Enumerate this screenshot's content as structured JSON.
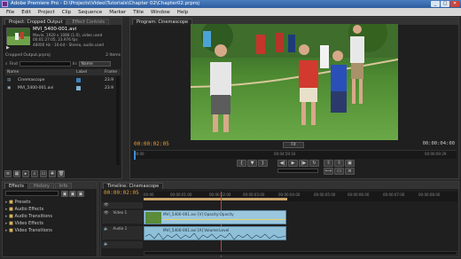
{
  "window": {
    "title": "Adobe Premiere Pro - D:\\Projects\\Video\\Tutorials\\Chapter 02\\Chapter02.prproj"
  },
  "menu": [
    "File",
    "Edit",
    "Project",
    "Clip",
    "Sequence",
    "Marker",
    "Title",
    "Window",
    "Help"
  ],
  "project_panel": {
    "tabs": [
      "Project: Cropped Output",
      "Effect Controls"
    ],
    "clip_name": "MVI_5400-001.avi",
    "clip_info_1": "Movie, 1920 x 1088 (1.0), video used",
    "clip_info_2": "00:01:27:05, 23.976 fps",
    "clip_info_3": "48000 Hz - 16-bit - Stereo, audio used",
    "project_name": "Cropped Output.prproj",
    "items_count": "2 Items",
    "find_label": "Find",
    "in_label": "In:",
    "in_value": "Name",
    "columns": [
      "Name",
      "Label",
      "Frame"
    ],
    "items": [
      {
        "name": "Cinemascope",
        "label_color": "#3b7fb8",
        "rate": "23.9"
      },
      {
        "name": "MVI_5400-001.avi",
        "label_color": "#7fb3d5",
        "rate": "23.9"
      }
    ]
  },
  "program_monitor": {
    "tab": "Program: Cinemascope",
    "current_time": "00:00:02:05",
    "duration": "00:00:04:00",
    "fit": "Fit",
    "ruler_labels": [
      "00:00",
      "00:04:59:16",
      "00:00:09:29"
    ]
  },
  "effects_panel": {
    "tabs": [
      "Effects",
      "History",
      "Info"
    ],
    "folders": [
      "Presets",
      "Audio Effects",
      "Audio Transitions",
      "Video Effects",
      "Video Transitions"
    ]
  },
  "timeline": {
    "tab": "Timeline: Cinemascope",
    "current_time": "00:00:02:05",
    "ruler_labels": [
      "00:00",
      "00:00:01:00",
      "00:00:02:00",
      "00:00:03:00",
      "00:00:04:00",
      "00:00:05:00",
      "00:00:06:00",
      "00:00:07:00",
      "00:00:08:00"
    ],
    "video_clip": "MVI_5400-001.avi [V] Opacity:Opacity",
    "audio_clip": "MVI_5400-001.avi [A] Volume:Level",
    "tracks": [
      "Video 3",
      "Video 2",
      "Video 1",
      "Audio 1",
      "Audio 2"
    ]
  },
  "colors": {
    "accent": "#e8a03a",
    "clip_video": "#9bc7de",
    "clip_audio": "#8fc0d8",
    "titlebar": "#2d5d9e"
  }
}
